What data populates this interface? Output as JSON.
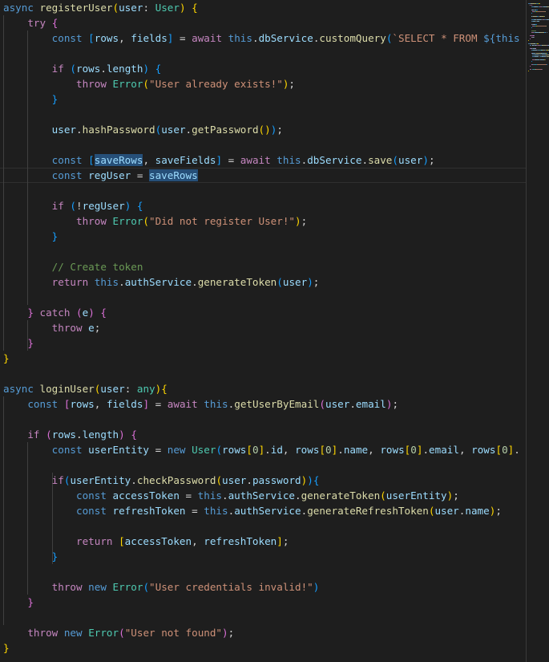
{
  "editor": {
    "language": "typescript",
    "lines": [
      [
        [
          "async ",
          "kw"
        ],
        [
          "registerUser",
          "fn"
        ],
        [
          "(",
          "b1"
        ],
        [
          "user",
          "var"
        ],
        [
          ": ",
          "pun"
        ],
        [
          "User",
          "type"
        ],
        [
          ")",
          "b1"
        ],
        [
          " ",
          "pun"
        ],
        [
          "{",
          "b1"
        ]
      ],
      [
        [
          "    ",
          "pun"
        ],
        [
          "try",
          "ctl"
        ],
        [
          " ",
          "pun"
        ],
        [
          "{",
          "b2"
        ]
      ],
      [
        [
          "        ",
          "pun"
        ],
        [
          "const ",
          "kw"
        ],
        [
          "[",
          "b3"
        ],
        [
          "rows",
          "var"
        ],
        [
          ", ",
          "pun"
        ],
        [
          "fields",
          "var"
        ],
        [
          "]",
          "b3"
        ],
        [
          " = ",
          "pun"
        ],
        [
          "await ",
          "ctl"
        ],
        [
          "this",
          "kw"
        ],
        [
          ".",
          "pun"
        ],
        [
          "dbService",
          "var"
        ],
        [
          ".",
          "pun"
        ],
        [
          "customQuery",
          "fn"
        ],
        [
          "(",
          "b3"
        ],
        [
          "`SELECT * FROM ",
          "str"
        ],
        [
          "${",
          "kw"
        ],
        [
          "this",
          "kw"
        ]
      ],
      [
        [
          "",
          "pun"
        ]
      ],
      [
        [
          "        ",
          "pun"
        ],
        [
          "if ",
          "ctl"
        ],
        [
          "(",
          "b3"
        ],
        [
          "rows",
          "var"
        ],
        [
          ".",
          "pun"
        ],
        [
          "length",
          "var"
        ],
        [
          ")",
          "b3"
        ],
        [
          " ",
          "pun"
        ],
        [
          "{",
          "b3"
        ]
      ],
      [
        [
          "            ",
          "pun"
        ],
        [
          "throw ",
          "ctl"
        ],
        [
          "Error",
          "type"
        ],
        [
          "(",
          "b1"
        ],
        [
          "\"User already exists!\"",
          "str"
        ],
        [
          ")",
          "b1"
        ],
        [
          ";",
          "pun"
        ]
      ],
      [
        [
          "        ",
          "pun"
        ],
        [
          "}",
          "b3"
        ]
      ],
      [
        [
          "",
          "pun"
        ]
      ],
      [
        [
          "        ",
          "pun"
        ],
        [
          "user",
          "var"
        ],
        [
          ".",
          "pun"
        ],
        [
          "hashPassword",
          "fn"
        ],
        [
          "(",
          "b3"
        ],
        [
          "user",
          "var"
        ],
        [
          ".",
          "pun"
        ],
        [
          "getPassword",
          "fn"
        ],
        [
          "()",
          "b1"
        ],
        [
          ")",
          "b3"
        ],
        [
          ";",
          "pun"
        ]
      ],
      [
        [
          "",
          "pun"
        ]
      ],
      [
        [
          "        ",
          "pun"
        ],
        [
          "const ",
          "kw"
        ],
        [
          "[",
          "b3"
        ],
        [
          "saveRows",
          "var",
          "hl"
        ],
        [
          ", ",
          "pun"
        ],
        [
          "saveFields",
          "var"
        ],
        [
          "]",
          "b3"
        ],
        [
          " = ",
          "pun"
        ],
        [
          "await ",
          "ctl"
        ],
        [
          "this",
          "kw"
        ],
        [
          ".",
          "pun"
        ],
        [
          "dbService",
          "var"
        ],
        [
          ".",
          "pun"
        ],
        [
          "save",
          "fn"
        ],
        [
          "(",
          "b3"
        ],
        [
          "user",
          "var"
        ],
        [
          ")",
          "b3"
        ],
        [
          ";",
          "pun"
        ]
      ],
      [
        [
          "        ",
          "pun"
        ],
        [
          "const ",
          "kw"
        ],
        [
          "regUser",
          "var"
        ],
        [
          " = ",
          "pun"
        ],
        [
          "saveRows",
          "var",
          "hl"
        ]
      ],
      [
        [
          "",
          "pun"
        ]
      ],
      [
        [
          "        ",
          "pun"
        ],
        [
          "if ",
          "ctl"
        ],
        [
          "(",
          "b3"
        ],
        [
          "!",
          "pun"
        ],
        [
          "regUser",
          "var"
        ],
        [
          ")",
          "b3"
        ],
        [
          " ",
          "pun"
        ],
        [
          "{",
          "b3"
        ]
      ],
      [
        [
          "            ",
          "pun"
        ],
        [
          "throw ",
          "ctl"
        ],
        [
          "Error",
          "type"
        ],
        [
          "(",
          "b1"
        ],
        [
          "\"Did not register User!\"",
          "str"
        ],
        [
          ")",
          "b1"
        ],
        [
          ";",
          "pun"
        ]
      ],
      [
        [
          "        ",
          "pun"
        ],
        [
          "}",
          "b3"
        ]
      ],
      [
        [
          "",
          "pun"
        ]
      ],
      [
        [
          "        ",
          "pun"
        ],
        [
          "// Create token",
          "com"
        ]
      ],
      [
        [
          "        ",
          "pun"
        ],
        [
          "return ",
          "ctl"
        ],
        [
          "this",
          "kw"
        ],
        [
          ".",
          "pun"
        ],
        [
          "authService",
          "var"
        ],
        [
          ".",
          "pun"
        ],
        [
          "generateToken",
          "fn"
        ],
        [
          "(",
          "b3"
        ],
        [
          "user",
          "var"
        ],
        [
          ")",
          "b3"
        ],
        [
          ";",
          "pun"
        ]
      ],
      [
        [
          "",
          "pun"
        ]
      ],
      [
        [
          "    ",
          "pun"
        ],
        [
          "}",
          "b2"
        ],
        [
          " ",
          "pun"
        ],
        [
          "catch ",
          "ctl"
        ],
        [
          "(",
          "b2"
        ],
        [
          "e",
          "var"
        ],
        [
          ")",
          "b2"
        ],
        [
          " ",
          "pun"
        ],
        [
          "{",
          "b2"
        ]
      ],
      [
        [
          "        ",
          "pun"
        ],
        [
          "throw ",
          "ctl"
        ],
        [
          "e",
          "var"
        ],
        [
          ";",
          "pun"
        ]
      ],
      [
        [
          "    ",
          "pun"
        ],
        [
          "}",
          "b2"
        ]
      ],
      [
        [
          "}",
          "b1"
        ]
      ],
      [
        [
          "",
          "pun"
        ]
      ],
      [
        [
          "async ",
          "kw"
        ],
        [
          "loginUser",
          "fn"
        ],
        [
          "(",
          "b1"
        ],
        [
          "user",
          "var"
        ],
        [
          ": ",
          "pun"
        ],
        [
          "any",
          "type"
        ],
        [
          ")",
          "b1"
        ],
        [
          "{",
          "b1"
        ]
      ],
      [
        [
          "    ",
          "pun"
        ],
        [
          "const ",
          "kw"
        ],
        [
          "[",
          "b2"
        ],
        [
          "rows",
          "var"
        ],
        [
          ", ",
          "pun"
        ],
        [
          "fields",
          "var"
        ],
        [
          "]",
          "b2"
        ],
        [
          " = ",
          "pun"
        ],
        [
          "await ",
          "ctl"
        ],
        [
          "this",
          "kw"
        ],
        [
          ".",
          "pun"
        ],
        [
          "getUserByEmail",
          "fn"
        ],
        [
          "(",
          "b2"
        ],
        [
          "user",
          "var"
        ],
        [
          ".",
          "pun"
        ],
        [
          "email",
          "var"
        ],
        [
          ")",
          "b2"
        ],
        [
          ";",
          "pun"
        ]
      ],
      [
        [
          "",
          "pun"
        ]
      ],
      [
        [
          "    ",
          "pun"
        ],
        [
          "if ",
          "ctl"
        ],
        [
          "(",
          "b2"
        ],
        [
          "rows",
          "var"
        ],
        [
          ".",
          "pun"
        ],
        [
          "length",
          "var"
        ],
        [
          ")",
          "b2"
        ],
        [
          " ",
          "pun"
        ],
        [
          "{",
          "b2"
        ]
      ],
      [
        [
          "        ",
          "pun"
        ],
        [
          "const ",
          "kw"
        ],
        [
          "userEntity",
          "var"
        ],
        [
          " = ",
          "pun"
        ],
        [
          "new ",
          "kw"
        ],
        [
          "User",
          "type"
        ],
        [
          "(",
          "b3"
        ],
        [
          "rows",
          "var"
        ],
        [
          "[",
          "b1"
        ],
        [
          "0",
          "num"
        ],
        [
          "]",
          "b1"
        ],
        [
          ".",
          "pun"
        ],
        [
          "id",
          "var"
        ],
        [
          ", ",
          "pun"
        ],
        [
          "rows",
          "var"
        ],
        [
          "[",
          "b1"
        ],
        [
          "0",
          "num"
        ],
        [
          "]",
          "b1"
        ],
        [
          ".",
          "pun"
        ],
        [
          "name",
          "var"
        ],
        [
          ", ",
          "pun"
        ],
        [
          "rows",
          "var"
        ],
        [
          "[",
          "b1"
        ],
        [
          "0",
          "num"
        ],
        [
          "]",
          "b1"
        ],
        [
          ".",
          "pun"
        ],
        [
          "email",
          "var"
        ],
        [
          ", ",
          "pun"
        ],
        [
          "rows",
          "var"
        ],
        [
          "[",
          "b1"
        ],
        [
          "0",
          "num"
        ],
        [
          "]",
          "b1"
        ],
        [
          ".",
          "pun"
        ]
      ],
      [
        [
          "",
          "pun"
        ]
      ],
      [
        [
          "        ",
          "pun"
        ],
        [
          "if",
          "ctl"
        ],
        [
          "(",
          "b3"
        ],
        [
          "userEntity",
          "var"
        ],
        [
          ".",
          "pun"
        ],
        [
          "checkPassword",
          "fn"
        ],
        [
          "(",
          "b1"
        ],
        [
          "user",
          "var"
        ],
        [
          ".",
          "pun"
        ],
        [
          "password",
          "var"
        ],
        [
          ")",
          "b1"
        ],
        [
          ")",
          "b3"
        ],
        [
          "{",
          "b3"
        ]
      ],
      [
        [
          "            ",
          "pun"
        ],
        [
          "const ",
          "kw"
        ],
        [
          "accessToken",
          "var"
        ],
        [
          " = ",
          "pun"
        ],
        [
          "this",
          "kw"
        ],
        [
          ".",
          "pun"
        ],
        [
          "authService",
          "var"
        ],
        [
          ".",
          "pun"
        ],
        [
          "generateToken",
          "fn"
        ],
        [
          "(",
          "b1"
        ],
        [
          "userEntity",
          "var"
        ],
        [
          ")",
          "b1"
        ],
        [
          ";",
          "pun"
        ]
      ],
      [
        [
          "            ",
          "pun"
        ],
        [
          "const ",
          "kw"
        ],
        [
          "refreshToken",
          "var"
        ],
        [
          " = ",
          "pun"
        ],
        [
          "this",
          "kw"
        ],
        [
          ".",
          "pun"
        ],
        [
          "authService",
          "var"
        ],
        [
          ".",
          "pun"
        ],
        [
          "generateRefreshToken",
          "fn"
        ],
        [
          "(",
          "b1"
        ],
        [
          "user",
          "var"
        ],
        [
          ".",
          "pun"
        ],
        [
          "name",
          "var"
        ],
        [
          ")",
          "b1"
        ],
        [
          ";",
          "pun"
        ]
      ],
      [
        [
          "",
          "pun"
        ]
      ],
      [
        [
          "            ",
          "pun"
        ],
        [
          "return ",
          "ctl"
        ],
        [
          "[",
          "b1"
        ],
        [
          "accessToken",
          "var"
        ],
        [
          ", ",
          "pun"
        ],
        [
          "refreshToken",
          "var"
        ],
        [
          "]",
          "b1"
        ],
        [
          ";",
          "pun"
        ]
      ],
      [
        [
          "        ",
          "pun"
        ],
        [
          "}",
          "b3"
        ]
      ],
      [
        [
          "",
          "pun"
        ]
      ],
      [
        [
          "        ",
          "pun"
        ],
        [
          "throw ",
          "ctl"
        ],
        [
          "new ",
          "kw"
        ],
        [
          "Error",
          "type"
        ],
        [
          "(",
          "b3"
        ],
        [
          "\"User credentials invalid!\"",
          "str"
        ],
        [
          ")",
          "b3"
        ]
      ],
      [
        [
          "    ",
          "pun"
        ],
        [
          "}",
          "b2"
        ]
      ],
      [
        [
          "",
          "pun"
        ]
      ],
      [
        [
          "    ",
          "pun"
        ],
        [
          "throw ",
          "ctl"
        ],
        [
          "new ",
          "kw"
        ],
        [
          "Error",
          "type"
        ],
        [
          "(",
          "b2"
        ],
        [
          "\"User not found\"",
          "str"
        ],
        [
          ")",
          "b2"
        ],
        [
          ";",
          "pun"
        ]
      ],
      [
        [
          "}",
          "b1"
        ]
      ]
    ]
  },
  "theme": {
    "background": "#1e1e1e",
    "keyword": "#569cd6",
    "control": "#c586c0",
    "variable": "#9cdcfe",
    "function": "#dcdcaa",
    "type": "#4ec9b0",
    "string": "#ce9178",
    "number": "#b5cea8",
    "comment": "#6a9955",
    "selection_highlight": "#264f78"
  }
}
